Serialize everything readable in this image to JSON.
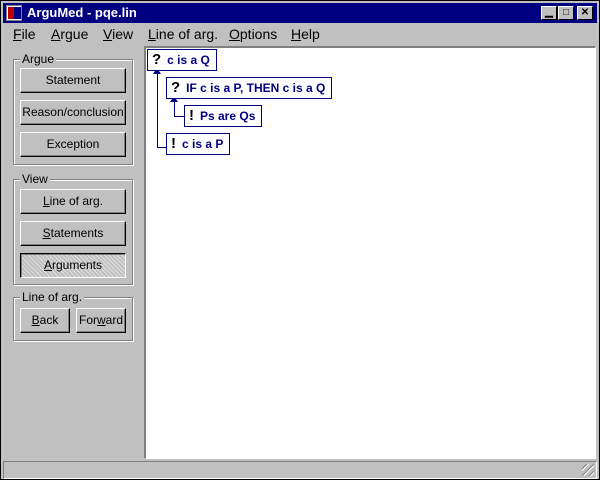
{
  "window": {
    "title": "ArguMed - pqe.lin"
  },
  "menu": [
    {
      "label": "File",
      "underline": "F",
      "rest": "ile"
    },
    {
      "label": "Argue",
      "underline": "A",
      "rest": "rgue"
    },
    {
      "label": "View",
      "underline": "V",
      "rest": "iew"
    },
    {
      "label": "Line of arg.",
      "underline": "L",
      "rest": "ine of arg."
    },
    {
      "label": "Options",
      "underline": "O",
      "rest": "ptions"
    },
    {
      "label": "Help",
      "underline": "H",
      "rest": "elp"
    }
  ],
  "argue_group": {
    "label": "Argue",
    "statement": "Statement",
    "reason": "Reason/conclusion",
    "exception": "Exception"
  },
  "view_group": {
    "label": "View",
    "line_u": "L",
    "line_rest": "ine of arg.",
    "statements_u": "S",
    "statements_rest": "tatements",
    "arguments_u": "A",
    "arguments_rest": "rguments"
  },
  "line_group": {
    "label": "Line of arg.",
    "back_u": "B",
    "back_rest": "ack",
    "forward_pre": "For",
    "forward_u": "w",
    "forward_rest": "ard"
  },
  "nodes": [
    {
      "mark": "?",
      "text": "c is a Q"
    },
    {
      "mark": "?",
      "text": "IF c is a P, THEN c is a Q"
    },
    {
      "mark": "!",
      "text": "Ps are Qs"
    },
    {
      "mark": "!",
      "text": "c is a P"
    }
  ]
}
